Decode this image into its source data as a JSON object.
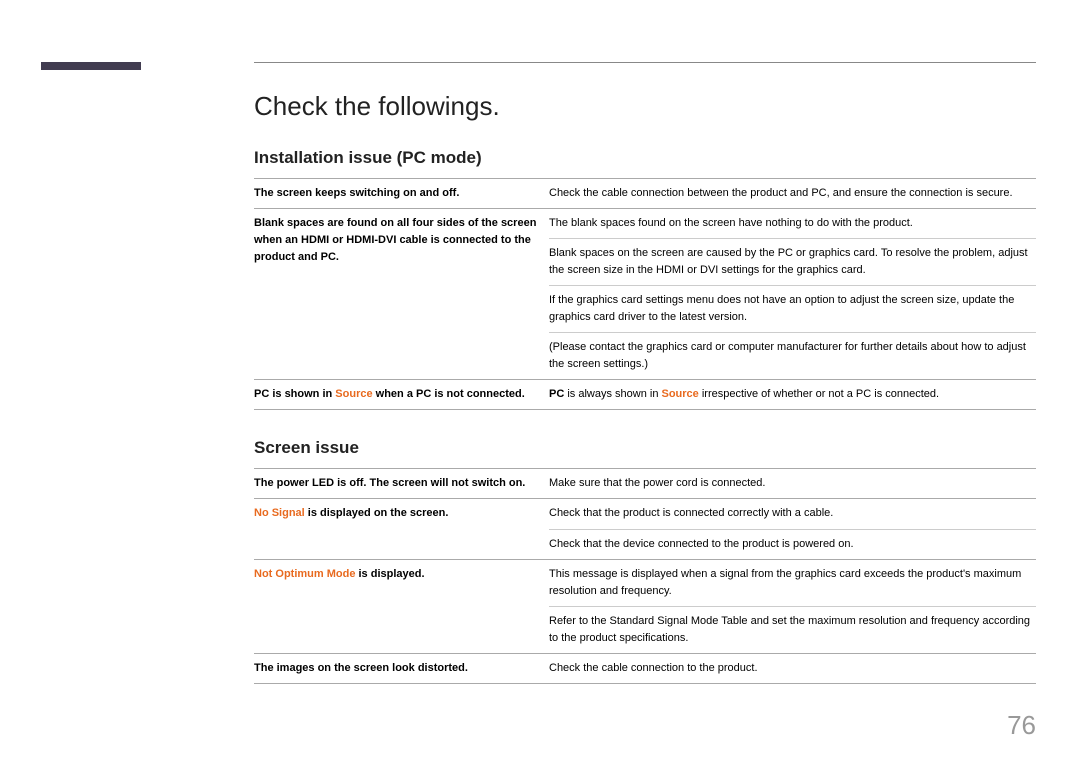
{
  "accent_color": "#413c50",
  "orange_color": "#e86a1f",
  "title": "Check the followings.",
  "sections": [
    {
      "heading": "Installation issue (PC mode)",
      "rows": [
        {
          "left_plain": "The screen keeps switching on and off.",
          "right": [
            "Check the cable connection between the product and PC, and ensure the connection is secure."
          ]
        },
        {
          "left_plain": "Blank spaces are found on all four sides of the screen when an HDMI or HDMI-DVI cable is connected to the product and PC.",
          "right": [
            "The blank spaces found on the screen have nothing to do with the product.",
            "Blank spaces on the screen are caused by the PC or graphics card. To resolve the problem, adjust the screen size in the HDMI or DVI settings for the graphics card.",
            "If the graphics card settings menu does not have an option to adjust the screen size, update the graphics card driver to the latest version.",
            "(Please contact the graphics card or computer manufacturer for further details about how to adjust the screen settings.)"
          ]
        },
        {
          "left_pc_source": {
            "pre": "PC is shown in ",
            "source": "Source",
            "post": " when a PC is not connected."
          },
          "right_pc_source": {
            "pre": "PC",
            "mid1": " is always shown in ",
            "source": "Source",
            "post": " irrespective of whether or not a PC is connected."
          }
        }
      ]
    },
    {
      "heading": "Screen issue",
      "rows": [
        {
          "left_plain": "The power LED is off. The screen will not switch on.",
          "right": [
            "Make sure that the power cord is connected."
          ]
        },
        {
          "left_hl": {
            "hl": "No Signal",
            "post": " is displayed on the screen."
          },
          "right": [
            "Check that the product is connected correctly with a cable.",
            "Check that the device connected to the product is powered on."
          ]
        },
        {
          "left_hl": {
            "hl": "Not Optimum Mode",
            "post": " is displayed."
          },
          "right": [
            "This message is displayed when a signal from the graphics card exceeds the product's maximum resolution and frequency.",
            "Refer to the Standard Signal Mode Table and set the maximum resolution and frequency according to the product specifications."
          ]
        },
        {
          "left_plain": "The images on the screen look distorted.",
          "right": [
            "Check the cable connection to the product."
          ]
        }
      ]
    }
  ],
  "page_number": "76"
}
